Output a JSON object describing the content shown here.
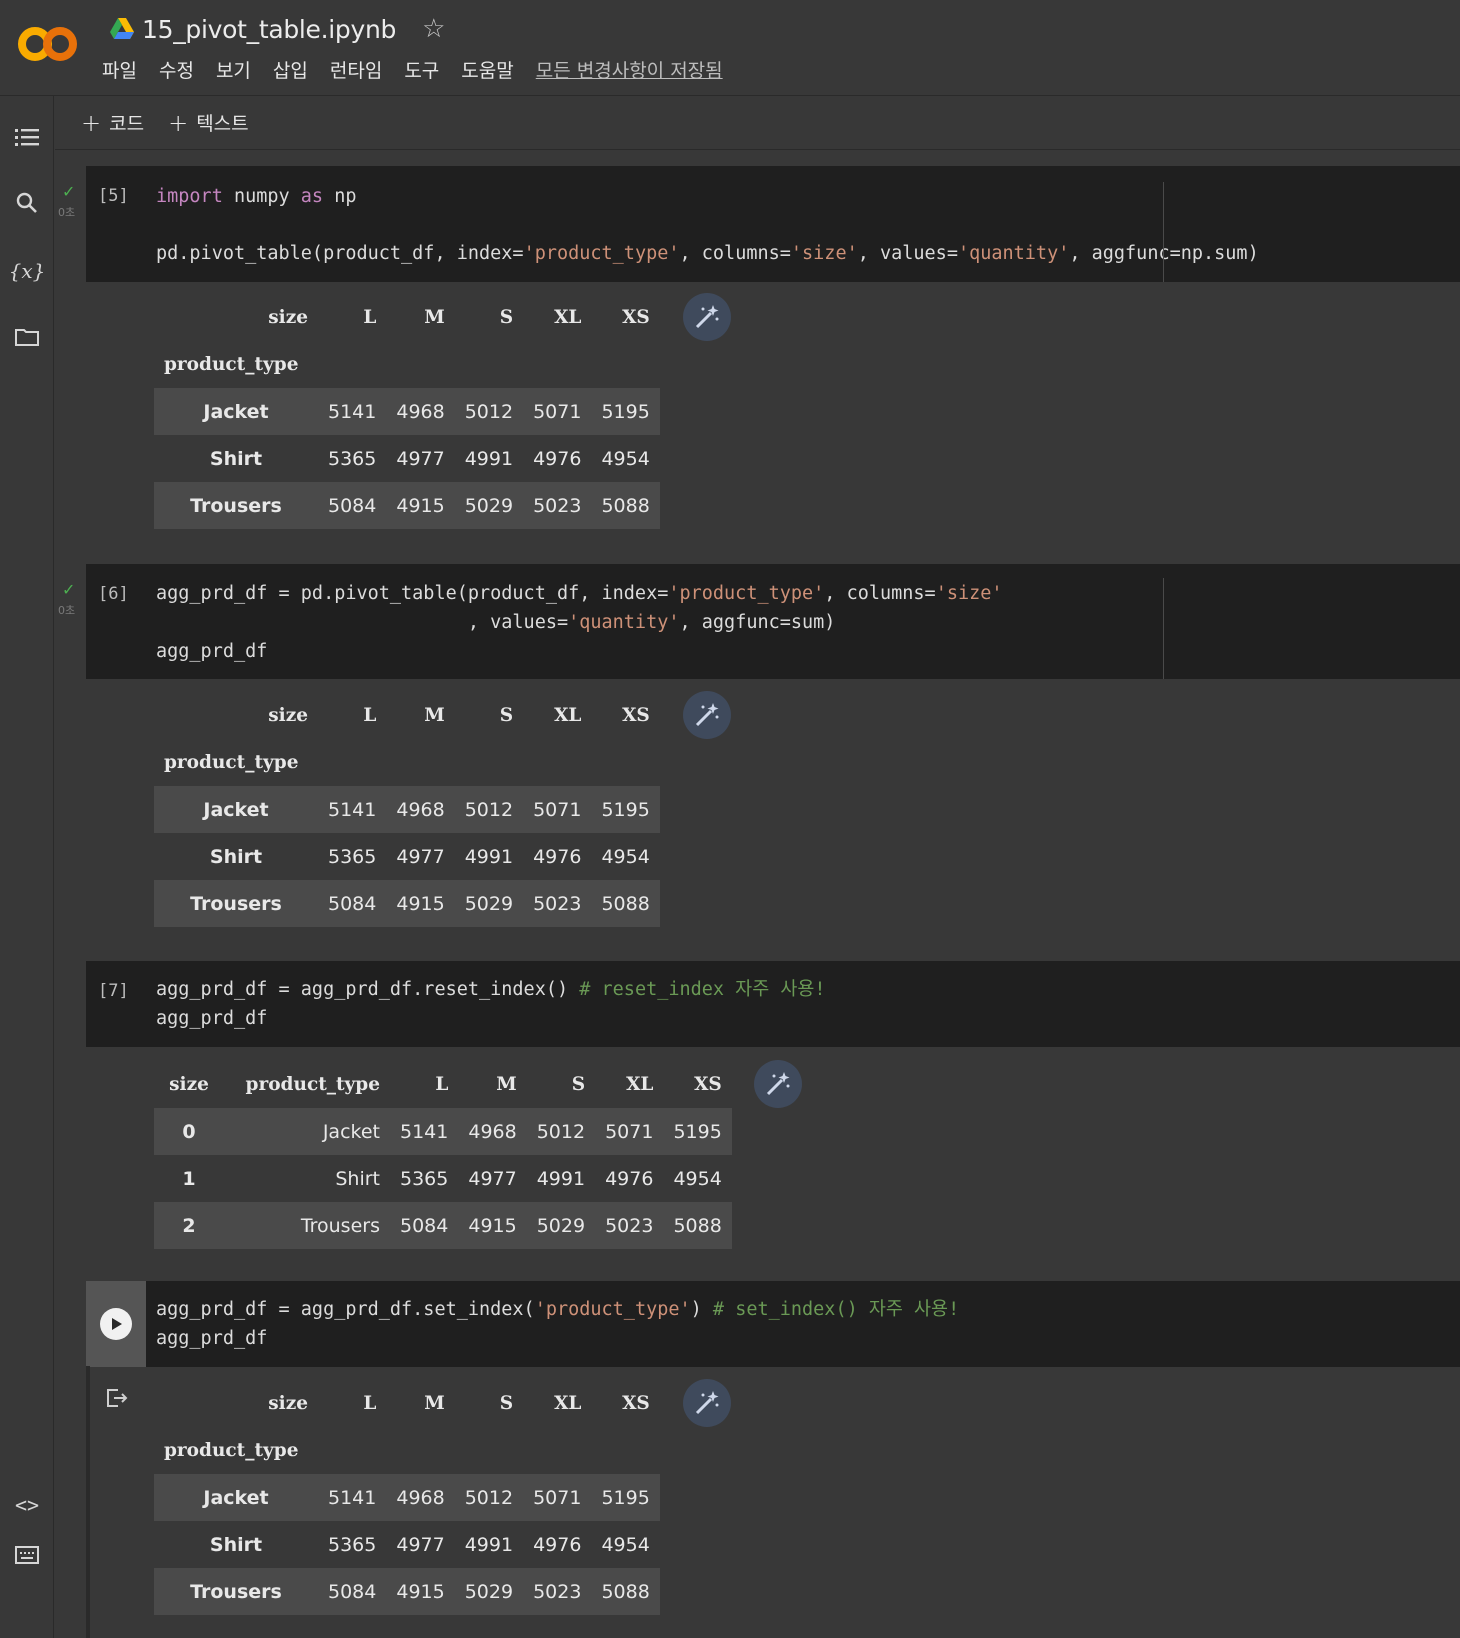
{
  "header": {
    "title": "15_pivot_table.ipynb",
    "menu": [
      "파일",
      "수정",
      "보기",
      "삽입",
      "런타임",
      "도구",
      "도움말"
    ],
    "saved_status": "모든 변경사항이 저장됨"
  },
  "toolbar": {
    "add_code": "코드",
    "add_text": "텍스트"
  },
  "rail_icons": [
    "toc-icon",
    "search-icon",
    "variables-icon",
    "folder-icon",
    "code-snippets-icon",
    "terminal-icon"
  ],
  "cells": [
    {
      "exec_label": "[5]",
      "status": "0초",
      "code_lines": [
        "import numpy as np",
        "",
        "pd.pivot_table(product_df, index='product_type', columns='size', values='quantity', aggfunc=np.sum)"
      ]
    },
    {
      "exec_label": "[6]",
      "status": "0초",
      "code_lines": [
        "agg_prd_df = pd.pivot_table(product_df, index='product_type', columns='size'",
        "                            , values='quantity', aggfunc=sum)",
        "agg_prd_df"
      ]
    },
    {
      "exec_label": "[7]",
      "code_lines": [
        "agg_prd_df = agg_prd_df.reset_index() # reset_index 자주 사용!",
        "agg_prd_df"
      ]
    },
    {
      "exec_label": "",
      "code_lines": [
        "agg_prd_df = agg_prd_df.set_index('product_type') # set_index() 자주 사용!",
        "agg_prd_df"
      ]
    }
  ],
  "pivot_table": {
    "columns_name": "size",
    "index_name": "product_type",
    "columns": [
      "L",
      "M",
      "S",
      "XL",
      "XS"
    ],
    "rows": [
      {
        "label": "Jacket",
        "values": [
          "5141",
          "4968",
          "5012",
          "5071",
          "5195"
        ]
      },
      {
        "label": "Shirt",
        "values": [
          "5365",
          "4977",
          "4991",
          "4976",
          "4954"
        ]
      },
      {
        "label": "Trousers",
        "values": [
          "5084",
          "4915",
          "5029",
          "5023",
          "5088"
        ]
      }
    ]
  },
  "reset_table": {
    "columns": [
      "size",
      "product_type",
      "L",
      "M",
      "S",
      "XL",
      "XS"
    ],
    "rows": [
      [
        "0",
        "Jacket",
        "5141",
        "4968",
        "5012",
        "5071",
        "5195"
      ],
      [
        "1",
        "Shirt",
        "5365",
        "4977",
        "4991",
        "4976",
        "4954"
      ],
      [
        "2",
        "Trousers",
        "5084",
        "4915",
        "5029",
        "5023",
        "5088"
      ]
    ]
  }
}
